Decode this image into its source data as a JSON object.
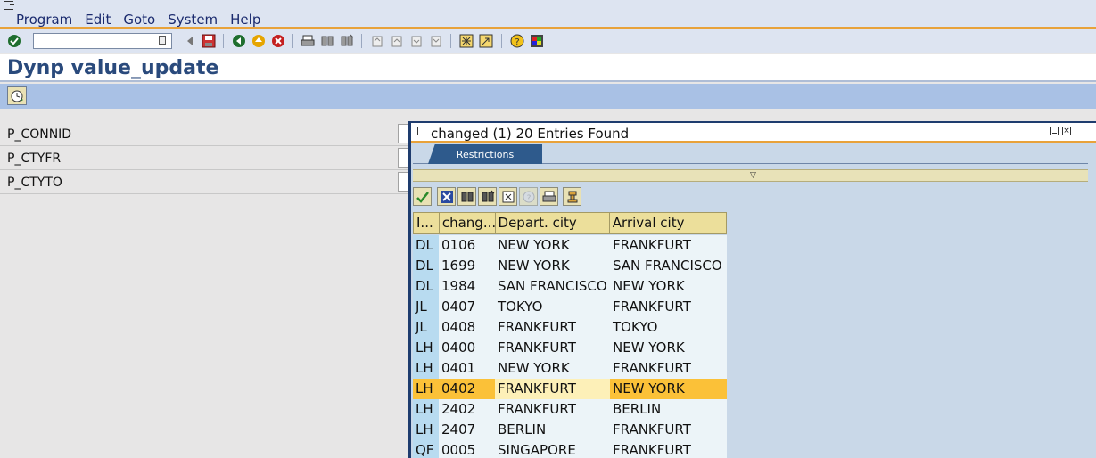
{
  "menu": {
    "items": [
      "Program",
      "Edit",
      "Goto",
      "System",
      "Help"
    ]
  },
  "toolbar": {
    "command_field_value": "",
    "icons": [
      "enter-icon",
      "back-arrow-icon",
      "save-icon",
      "back-icon",
      "exit-icon",
      "cancel-icon",
      "print-icon",
      "find-icon",
      "find-next-icon",
      "first-page-icon",
      "prev-page-icon",
      "next-page-icon",
      "last-page-icon",
      "create-session-icon",
      "shortcut-icon",
      "help-icon",
      "customize-layout-icon"
    ]
  },
  "page": {
    "title": "Dynp value_update"
  },
  "parameters": [
    {
      "label": "P_CONNID",
      "value": ""
    },
    {
      "label": "P_CTYFR",
      "value": ""
    },
    {
      "label": "P_CTYTO",
      "value": ""
    }
  ],
  "popup": {
    "title": "changed (1)   20 Entries Found",
    "tab_label": "Restrictions",
    "toolbar_icons": [
      "continue-check-icon",
      "cancel-x-icon",
      "find-icon",
      "find-next-icon",
      "sort-icon",
      "info-icon",
      "print-icon",
      "personal-value-list-icon"
    ],
    "columns": [
      "I...",
      "chang...",
      "Depart. city",
      "Arrival city"
    ],
    "rows": [
      [
        "DL",
        "0106",
        "NEW YORK",
        "FRANKFURT"
      ],
      [
        "DL",
        "1699",
        "NEW YORK",
        "SAN FRANCISCO"
      ],
      [
        "DL",
        "1984",
        "SAN FRANCISCO",
        "NEW YORK"
      ],
      [
        "JL",
        "0407",
        "TOKYO",
        "FRANKFURT"
      ],
      [
        "JL",
        "0408",
        "FRANKFURT",
        "TOKYO"
      ],
      [
        "LH",
        "0400",
        "FRANKFURT",
        "NEW YORK"
      ],
      [
        "LH",
        "0401",
        "NEW YORK",
        "FRANKFURT"
      ],
      [
        "LH",
        "0402",
        "FRANKFURT",
        "NEW YORK"
      ],
      [
        "LH",
        "2402",
        "FRANKFURT",
        "BERLIN"
      ],
      [
        "LH",
        "2407",
        "BERLIN",
        "FRANKFURT"
      ],
      [
        "QF",
        "0005",
        "SINGAPORE",
        "FRANKFURT"
      ]
    ],
    "selected_row_index": 7
  },
  "colors": {
    "accent_orange": "#e8a23a",
    "header_blue": "#2a4a7c",
    "selected_row": "#fbc138",
    "grid_header": "#ecdf9b"
  }
}
